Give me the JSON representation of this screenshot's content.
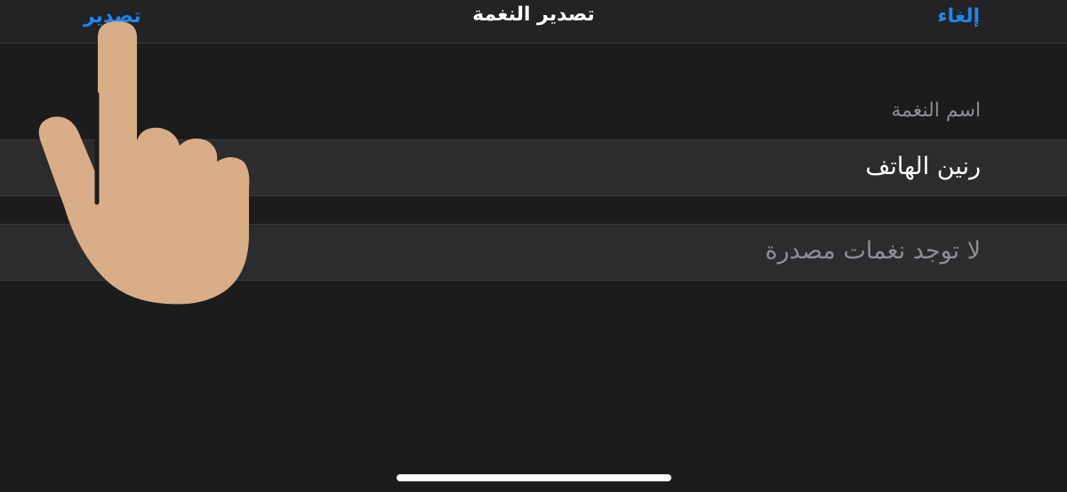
{
  "navbar": {
    "title": "تصدير النغمة",
    "cancel_label": "إلغاء",
    "export_label": "تصدير"
  },
  "form": {
    "section_header": "اسم النغمة",
    "ringtone_name": "رنين الهاتف",
    "empty_message": "لا توجد نغمات مصدرة"
  },
  "colors": {
    "background": "#1c1c1e",
    "row_background": "#2c2c2e",
    "accent": "#1e86f0",
    "secondary_text": "#8e8e93",
    "hand": "#d8ad88"
  },
  "icons": {
    "overlay": "pointing-hand-icon"
  }
}
